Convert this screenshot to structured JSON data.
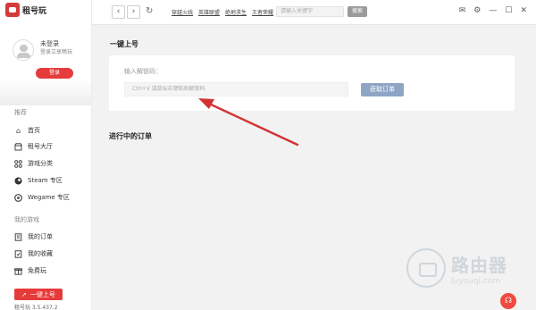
{
  "brand": {
    "name": "租号玩"
  },
  "user": {
    "status": "未登录",
    "prompt": "登录立享畅玩",
    "login_label": "登录"
  },
  "sidebar": {
    "recommend_title": "推荐",
    "items": [
      {
        "icon": "home-icon",
        "label": "首页"
      },
      {
        "icon": "shop-icon",
        "label": "租号大厅"
      },
      {
        "icon": "grid-icon",
        "label": "游戏分类"
      },
      {
        "icon": "steam-icon",
        "label": "Steam 专区"
      },
      {
        "icon": "wegame-icon",
        "label": "Wegame 专区"
      }
    ],
    "my_games_title": "我的游戏",
    "my_items": [
      {
        "icon": "orders-icon",
        "label": "我的订单"
      },
      {
        "icon": "favorites-icon",
        "label": "我的收藏"
      },
      {
        "icon": "free-icon",
        "label": "免费玩"
      }
    ],
    "quick_button": "一键上号",
    "version": "租号玩 3.5.437.2"
  },
  "topbar": {
    "quick_links": [
      "穿越火线",
      "英雄联盟",
      "绝地求生",
      "王者荣耀"
    ],
    "search_placeholder": "请输入关键字",
    "search_button": "搜索"
  },
  "main": {
    "title": "一键上号",
    "redeem_label": "输入解锁码：",
    "redeem_placeholder": "Ctrl+V 或鼠标右键粘贴解锁码",
    "redeem_button": "获取订单",
    "orders_title": "进行中的订单"
  },
  "watermark": {
    "title": "路由器",
    "site": "luyouqi.com"
  },
  "colors": {
    "accent": "#e63b3b",
    "button_disabled": "#8fa5c6",
    "annotation": "#d33333"
  }
}
